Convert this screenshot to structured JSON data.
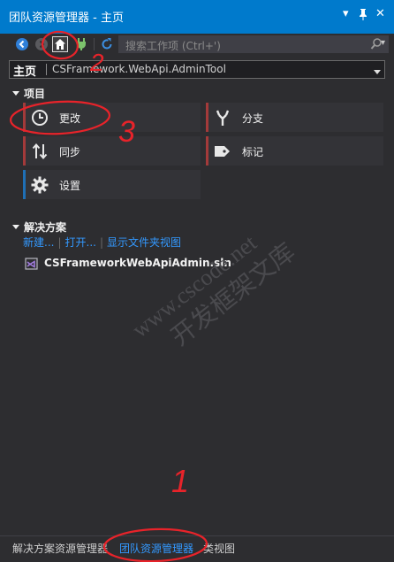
{
  "window": {
    "title": "团队资源管理器 - 主页",
    "buttons": {
      "dropdown": "▾",
      "pin": "🖈",
      "close": "✕"
    }
  },
  "toolbar": {
    "search_placeholder": "搜索工作项 (Ctrl+')",
    "icons": [
      "back-arrow-icon",
      "forward-arrow-icon",
      "home-icon",
      "plug-icon",
      "refresh-icon",
      "search-icon"
    ]
  },
  "page_bar": {
    "page_name": "主页",
    "context": "CSFramework.WebApi.AdminTool"
  },
  "project_section": {
    "header": "项目",
    "tiles": [
      {
        "label": "更改",
        "icon": "clock-icon",
        "accent": "#a33a3a"
      },
      {
        "label": "分支",
        "icon": "branch-icon",
        "accent": "#a33a3a"
      },
      {
        "label": "同步",
        "icon": "sync-arrows-icon",
        "accent": "#a33a3a"
      },
      {
        "label": "标记",
        "icon": "tag-icon",
        "accent": "#a33a3a"
      },
      {
        "label": "设置",
        "icon": "gear-icon",
        "accent": "#1f6fb5"
      }
    ]
  },
  "solutions_section": {
    "header": "解决方案",
    "links": [
      "新建...",
      "打开...",
      "显示文件夹视图"
    ],
    "solution_file": "CSFrameworkWebApiAdmin.sln"
  },
  "bottom_tabs": {
    "tabs": [
      "解决方案资源管理器",
      "团队资源管理器",
      "类视图"
    ],
    "active_index": 1
  },
  "annotations": {
    "labels": [
      "1",
      "2",
      "3"
    ],
    "color": "#e8232a"
  },
  "watermark": {
    "lines": [
      "www.cscode.net",
      "开发框架文库"
    ]
  },
  "colors": {
    "accent_blue": "#007acc",
    "link_blue": "#3399ff",
    "panel_bg": "#2d2d30",
    "tile_bg": "#333337"
  }
}
